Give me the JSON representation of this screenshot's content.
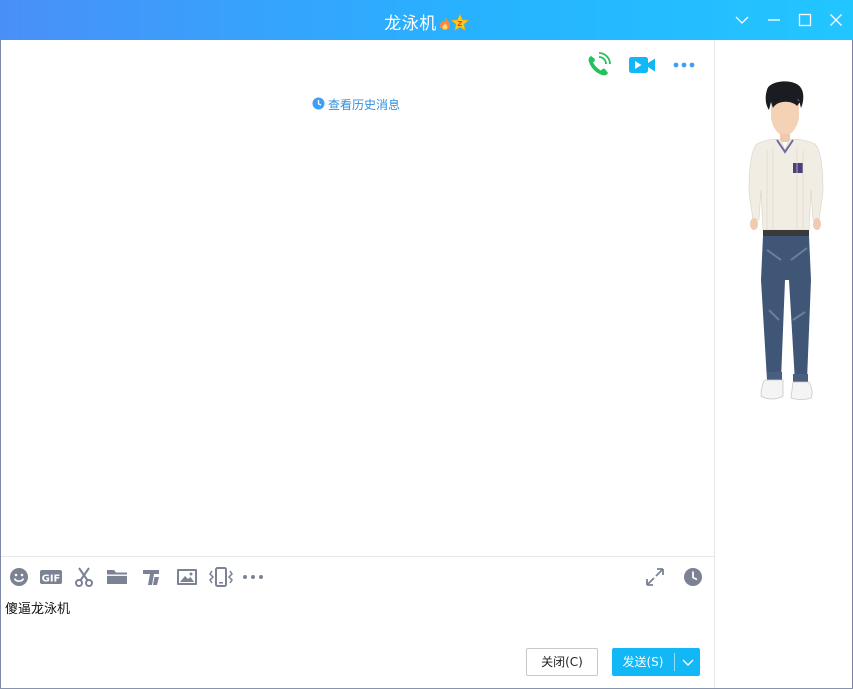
{
  "window": {
    "title": "龙泳机",
    "title_badges": [
      "flame-icon",
      "star-icon"
    ],
    "controls": [
      "collapse-icon",
      "minimize-icon",
      "maximize-icon",
      "close-icon"
    ]
  },
  "chat_header": {
    "actions": [
      "voice-call-icon",
      "video-call-icon",
      "more-icon"
    ],
    "history_link": "查看历史消息"
  },
  "toolbar": {
    "left_tools": [
      "emoji-icon",
      "gif-icon",
      "screenshot-scissors-icon",
      "folder-icon",
      "font-icon",
      "image-icon",
      "shake-window-icon",
      "more-tools-icon"
    ],
    "right_tools": [
      "expand-icon",
      "history-clock-icon"
    ]
  },
  "input": {
    "value": "傻逼龙泳机"
  },
  "buttons": {
    "close_label": "关闭(C)",
    "send_label": "发送(S)"
  },
  "side_panel": {
    "avatar": "show-avatar-figure"
  },
  "colors": {
    "titlebar_start": "#4a8ff8",
    "titlebar_end": "#22c6ff",
    "send_button": "#12b7f5",
    "link": "#2e8fe0",
    "voice_icon": "#20c35a",
    "video_icon": "#12b7f5",
    "toolbar_icon": "#7a8294"
  }
}
